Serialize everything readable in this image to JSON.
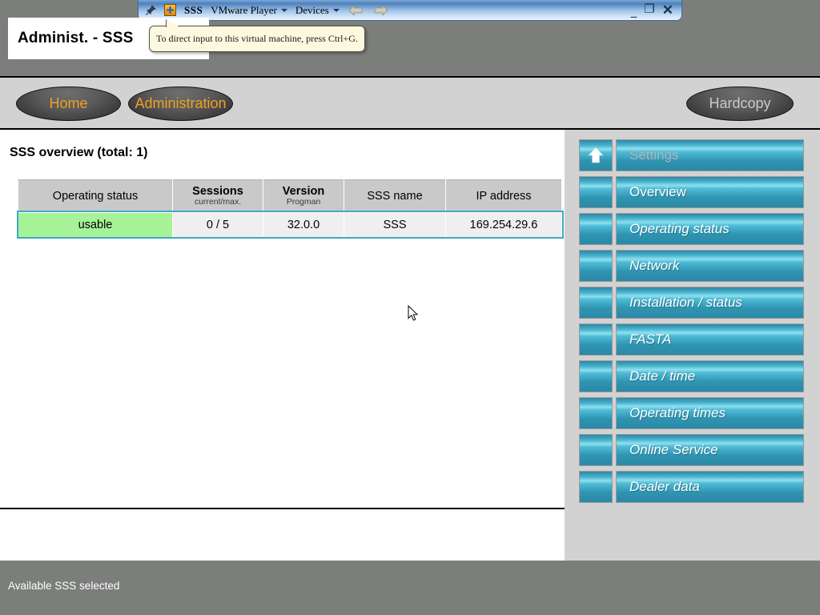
{
  "vm_titlebar": {
    "pin_icon": "pin-icon",
    "vm_icon": "vmware-machine-icon",
    "machine_name": "SSS",
    "menu_player": "VMware Player",
    "menu_devices": "Devices",
    "back_icon": "back-arrow-icon",
    "forward_icon": "forward-arrow-icon",
    "minimize_label": "_",
    "restore_label": "❐",
    "close_label": "✕"
  },
  "tooltip": {
    "text": "To direct input to this virtual machine, press Ctrl+G."
  },
  "header": {
    "title": "Administ. - SSS",
    "nav": [
      {
        "label": "Home",
        "id": "home"
      },
      {
        "label": "Administration",
        "id": "administration"
      }
    ],
    "hardcopy_label": "Hardcopy"
  },
  "main": {
    "heading": "SSS overview (total: 1)",
    "table": {
      "columns": [
        {
          "label": "Operating status",
          "sub": ""
        },
        {
          "label": "Sessions",
          "sub": "current/max."
        },
        {
          "label": "Version",
          "sub": "Progman"
        },
        {
          "label": "SSS name",
          "sub": ""
        },
        {
          "label": "IP address",
          "sub": ""
        }
      ],
      "rows": [
        {
          "operating_status": "usable",
          "sessions": "0 / 5",
          "version": "32.0.0",
          "sss_name": "SSS",
          "ip_address": "169.254.29.6"
        }
      ]
    }
  },
  "sidebar": {
    "items": [
      {
        "label": "Settings",
        "style": "disabled",
        "icon": "up-arrow-icon"
      },
      {
        "label": "Overview",
        "style": "upright",
        "icon": ""
      },
      {
        "label": "Operating status",
        "style": "italic",
        "icon": ""
      },
      {
        "label": "Network",
        "style": "italic",
        "icon": ""
      },
      {
        "label": "Installation / status",
        "style": "italic",
        "icon": ""
      },
      {
        "label": "FASTA",
        "style": "italic",
        "icon": ""
      },
      {
        "label": "Date / time",
        "style": "italic",
        "icon": ""
      },
      {
        "label": "Operating times",
        "style": "italic",
        "icon": ""
      },
      {
        "label": "Online Service",
        "style": "italic",
        "icon": ""
      },
      {
        "label": "Dealer data",
        "style": "italic",
        "icon": ""
      }
    ]
  },
  "statusbar": {
    "text": "Available SSS selected"
  },
  "colors": {
    "accent_teal": "#3fa9c9",
    "status_ok_green": "#a6f297",
    "nav_text_orange": "#f0a024",
    "panel_gray": "#d2d2d2",
    "chrome_gray": "#7b7e7b"
  }
}
